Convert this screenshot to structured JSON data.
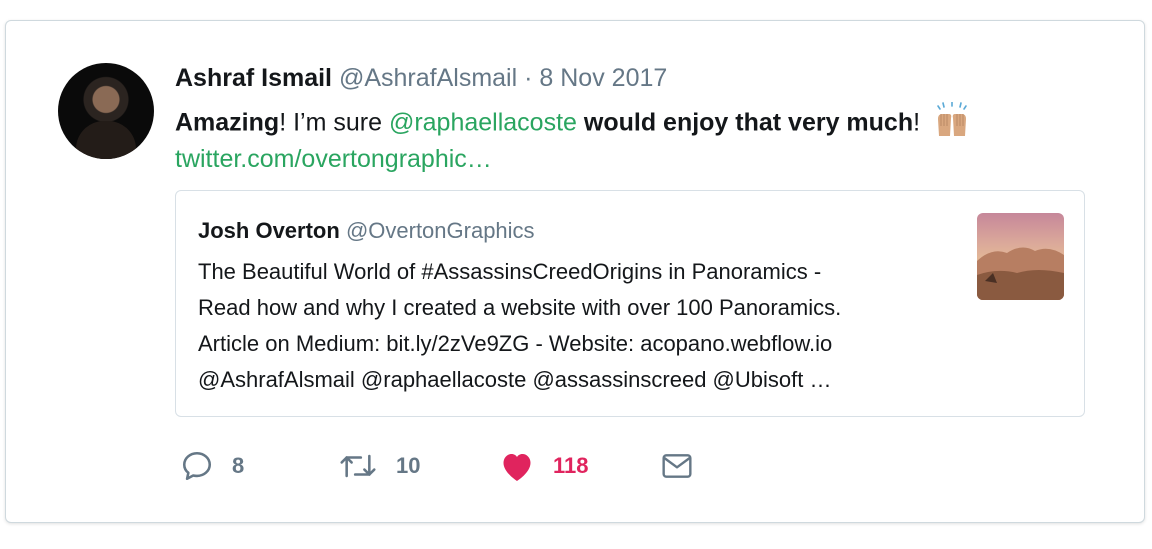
{
  "tweet": {
    "author_name": "Ashraf Ismail",
    "author_handle": "@AshrafAlsmail",
    "separator": "·",
    "date": "8 Nov 2017",
    "text": {
      "part1_bold": "Amazing",
      "part2": "! I’m sure ",
      "mention": "@raphaellacoste",
      "part3_bold": " would enjoy that very much",
      "part4": "!"
    },
    "link": "twitter.com/overtongraphic…"
  },
  "quoted_tweet": {
    "author_name": "Josh Overton",
    "author_handle": "@OvertonGraphics",
    "lines": [
      "The Beautiful World of #AssassinsCreedOrigins in Panoramics -",
      "Read how and why I created a website with over 100 Panoramics.",
      "Article on Medium: bit.ly/2zVe9ZG - Website: acopano.webflow.io",
      "@AshrafAlsmail @raphaellacoste @assassinscreed @Ubisoft …"
    ]
  },
  "actions": {
    "replies": "8",
    "retweets": "10",
    "likes": "118",
    "liked": true
  },
  "colors": {
    "link": "#2aa560",
    "muted": "#657786",
    "like": "#e0245e"
  },
  "icons": [
    "reply-icon",
    "retweet-icon",
    "heart-icon",
    "mail-icon",
    "raised-hands-emoji"
  ]
}
